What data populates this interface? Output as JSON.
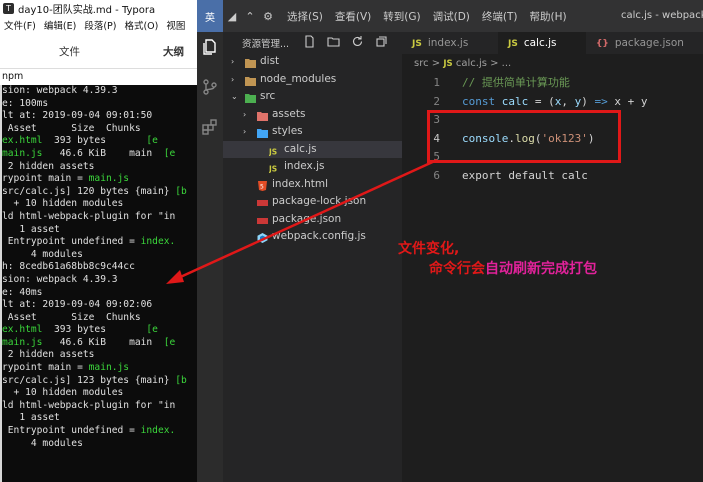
{
  "typora": {
    "title": "day10-团队实战.md - Typora",
    "menu": [
      "文件(F)",
      "编辑(E)",
      "段落(P)",
      "格式(O)",
      "视图"
    ],
    "tabs": {
      "files": "文件",
      "outline": "大纲"
    },
    "section_label": "npm"
  },
  "terminal": {
    "lines": [
      [
        {
          "t": "sion: webpack 4.39.3"
        }
      ],
      [
        {
          "t": "e: 100ms"
        }
      ],
      [
        {
          "t": "lt at: 2019-09-04 09:01:50"
        }
      ],
      [
        {
          "t": " Asset      Size  Chunks            "
        }
      ],
      [
        {
          "t": "ex.html",
          "g": true
        },
        {
          "t": "  393 bytes       "
        },
        {
          "t": "[e",
          "g": true
        }
      ],
      [
        {
          "t": "main.js",
          "g": true
        },
        {
          "t": "   46.6 KiB    main  "
        },
        {
          "t": "[e",
          "g": true
        }
      ],
      [
        {
          "t": " 2 hidden assets"
        }
      ],
      [
        {
          "t": "rypoint main = "
        },
        {
          "t": "main.js",
          "g": true
        }
      ],
      [
        {
          "t": "src/calc.js] 120 bytes {main} "
        },
        {
          "t": "[b",
          "g": true
        }
      ],
      [
        {
          "t": "  + 10 hidden modules"
        }
      ],
      [
        {
          "t": "ld html-webpack-plugin for \"in"
        }
      ],
      [
        {
          "t": "   1 asset"
        }
      ],
      [
        {
          "t": " Entrypoint undefined = "
        },
        {
          "t": "index.",
          "g": true
        }
      ],
      [
        {
          "t": "     4 modules"
        }
      ],
      [
        {
          "t": "h: 8cedb61a68bb8c9c44cc"
        }
      ],
      [
        {
          "t": "sion: webpack 4.39.3"
        }
      ],
      [
        {
          "t": "e: 40ms"
        }
      ],
      [
        {
          "t": "lt at: 2019-09-04 09:02:06"
        }
      ],
      [
        {
          "t": " Asset      Size  Chunks            "
        }
      ],
      [
        {
          "t": "ex.html",
          "g": true
        },
        {
          "t": "  393 bytes       "
        },
        {
          "t": "[e",
          "g": true
        }
      ],
      [
        {
          "t": "main.js",
          "g": true
        },
        {
          "t": "   46.6 KiB    main  "
        },
        {
          "t": "[e",
          "g": true
        }
      ],
      [
        {
          "t": " 2 hidden assets"
        }
      ],
      [
        {
          "t": "rypoint main = "
        },
        {
          "t": "main.js",
          "g": true
        }
      ],
      [
        {
          "t": "src/calc.js] 123 bytes {main} "
        },
        {
          "t": "[b",
          "g": true
        }
      ],
      [
        {
          "t": "  + 10 hidden modules"
        }
      ],
      [
        {
          "t": "ld html-webpack-plugin for \"in"
        }
      ],
      [
        {
          "t": "   1 asset"
        }
      ],
      [
        {
          "t": " Entrypoint undefined = "
        },
        {
          "t": "index.",
          "g": true
        }
      ],
      [
        {
          "t": "     4 modules"
        }
      ]
    ]
  },
  "vscode": {
    "logo": "英",
    "title_icons": [
      "◢",
      "⌃",
      "⚙"
    ],
    "menu": [
      "选择(S)",
      "查看(V)",
      "转到(G)",
      "调试(D)",
      "终端(T)",
      "帮助(H)"
    ],
    "window_title": "calc.js - webpack-d",
    "explorer_title": "资源管理...",
    "tree": [
      {
        "label": "dist",
        "chev": "›",
        "icon": "folder",
        "depth": 1
      },
      {
        "label": "node_modules",
        "chev": "›",
        "icon": "folder",
        "depth": 1
      },
      {
        "label": "src",
        "chev": "⌄",
        "icon": "folder-src",
        "depth": 1
      },
      {
        "label": "assets",
        "chev": "›",
        "icon": "folder-assets",
        "depth": 2
      },
      {
        "label": "styles",
        "chev": "›",
        "icon": "folder-styles",
        "depth": 2
      },
      {
        "label": "calc.js",
        "icon": "js",
        "depth": 3,
        "selected": true
      },
      {
        "label": "index.js",
        "icon": "js",
        "depth": 3
      },
      {
        "label": "index.html",
        "icon": "html",
        "depth": 2
      },
      {
        "label": "package-lock.json",
        "icon": "json",
        "depth": 2
      },
      {
        "label": "package.json",
        "icon": "json",
        "depth": 2
      },
      {
        "label": "webpack.config.js",
        "icon": "webpack",
        "depth": 2
      }
    ],
    "tabs": [
      {
        "label": "index.js",
        "icon": "JS"
      },
      {
        "label": "calc.js",
        "icon": "JS",
        "active": true
      },
      {
        "label": "package.json",
        "icon": "{}"
      }
    ],
    "breadcrumb": {
      "folder": "src",
      "sep": ">",
      "file_icon": "JS",
      "file": "calc.js",
      "tail": "> ..."
    },
    "code": [
      {
        "num": "1",
        "tokens": [
          {
            "t": "// 提供简单计算功能",
            "c": "c-comment"
          }
        ]
      },
      {
        "num": "2",
        "tokens": [
          {
            "t": "const ",
            "c": "c-kw"
          },
          {
            "t": "calc",
            "c": "c-var"
          },
          {
            "t": " = (",
            "c": "c-plain"
          },
          {
            "t": "x",
            "c": "c-var"
          },
          {
            "t": ", ",
            "c": "c-plain"
          },
          {
            "t": "y",
            "c": "c-var"
          },
          {
            "t": ") ",
            "c": "c-plain"
          },
          {
            "t": "=>",
            "c": "c-kw"
          },
          {
            "t": " x + y",
            "c": "c-plain"
          }
        ]
      },
      {
        "num": "3",
        "tokens": []
      },
      {
        "num": "4",
        "current": true,
        "tokens": [
          {
            "t": "console",
            "c": "c-var"
          },
          {
            "t": ".",
            "c": "c-plain"
          },
          {
            "t": "log",
            "c": "c-fn"
          },
          {
            "t": "(",
            "c": "c-plain"
          },
          {
            "t": "'ok123'",
            "c": "c-str"
          },
          {
            "t": ")",
            "c": "c-plain"
          }
        ]
      },
      {
        "num": "5",
        "tokens": []
      },
      {
        "num": "6",
        "tokens": [
          {
            "t": "export default calc",
            "c": "c-plain"
          }
        ]
      }
    ]
  },
  "annotation": {
    "line1": "文件变化,",
    "line2_a": "命令行会",
    "line2_b": "自动刷新完成打包"
  },
  "colors": {
    "annotation_red": "#e01818",
    "annotation_magenta": "#e1229a",
    "terminal_green": "#3bd63b"
  }
}
